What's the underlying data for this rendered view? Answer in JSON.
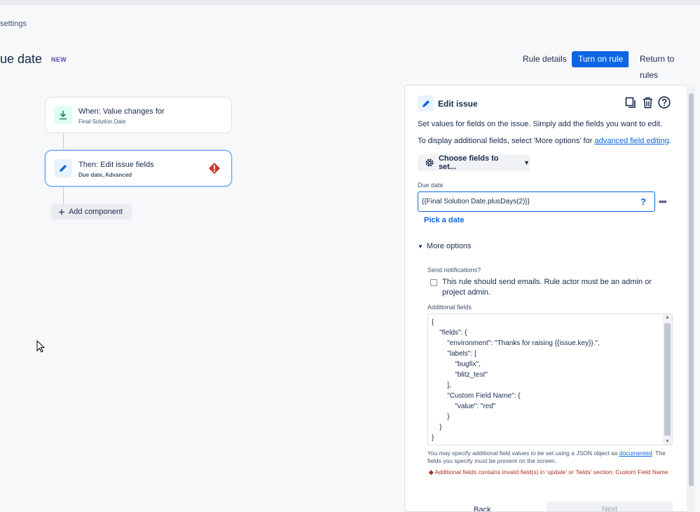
{
  "breadcrumb": {
    "text": "settings"
  },
  "header": {
    "title": "ue date",
    "badge": "NEW",
    "rule_details": "Rule details",
    "turn_on": "Turn on rule",
    "return": "Return to rules"
  },
  "canvas": {
    "trigger": {
      "title": "When: Value changes for",
      "subtitle": "Final Solution Date",
      "icon": "trigger-icon"
    },
    "action": {
      "title": "Then: Edit issue fields",
      "subtitle": "Due date, Advanced",
      "icon": "pencil-icon",
      "status": "error"
    },
    "add_component": "Add component"
  },
  "panel": {
    "title": "Edit issue",
    "description": "Set values for fields on the issue. Simply add the fields you want to edit.",
    "display_hint_prefix": "To display additional fields, select 'More options' for ",
    "display_hint_link": "advanced field editing",
    "display_hint_suffix": ".",
    "choose_fields": "Choose fields to set...",
    "due_date_label": "Due date",
    "due_date_value": "{{Final Solution Date.plusDays(2)}}",
    "pick_date": "Pick a date",
    "more_options": "More options",
    "send_notifications_label": "Send notifications?",
    "send_notifications_text": "This rule should send emails. Rule actor must be an admin or project admin.",
    "additional_fields_label": "Additional fields",
    "additional_fields_value": "{\n    \"fields\": {\n        \"environment\": \"Thanks for raising {{issue.key}}.\",\n        \"labels\": [\n            \"bugfix\",\n            \"blitz_test\"\n        ],\n        \"Custom Field Name\": {\n            \"value\": \"red\"\n        }\n    }\n}",
    "help_prefix": "You may specify additional field values to be set using a JSON object as ",
    "help_link": "documented",
    "help_suffix": ". The fields you specify must be present on the screen.",
    "error": "Additional fields contains invalid field(s) in 'update' or 'fields' section: Custom Field Name",
    "back": "Back",
    "next": "Next"
  },
  "colors": {
    "primary": "#0c66e4",
    "error": "#ae2e24",
    "trigger_bg": "#dcfff1"
  }
}
